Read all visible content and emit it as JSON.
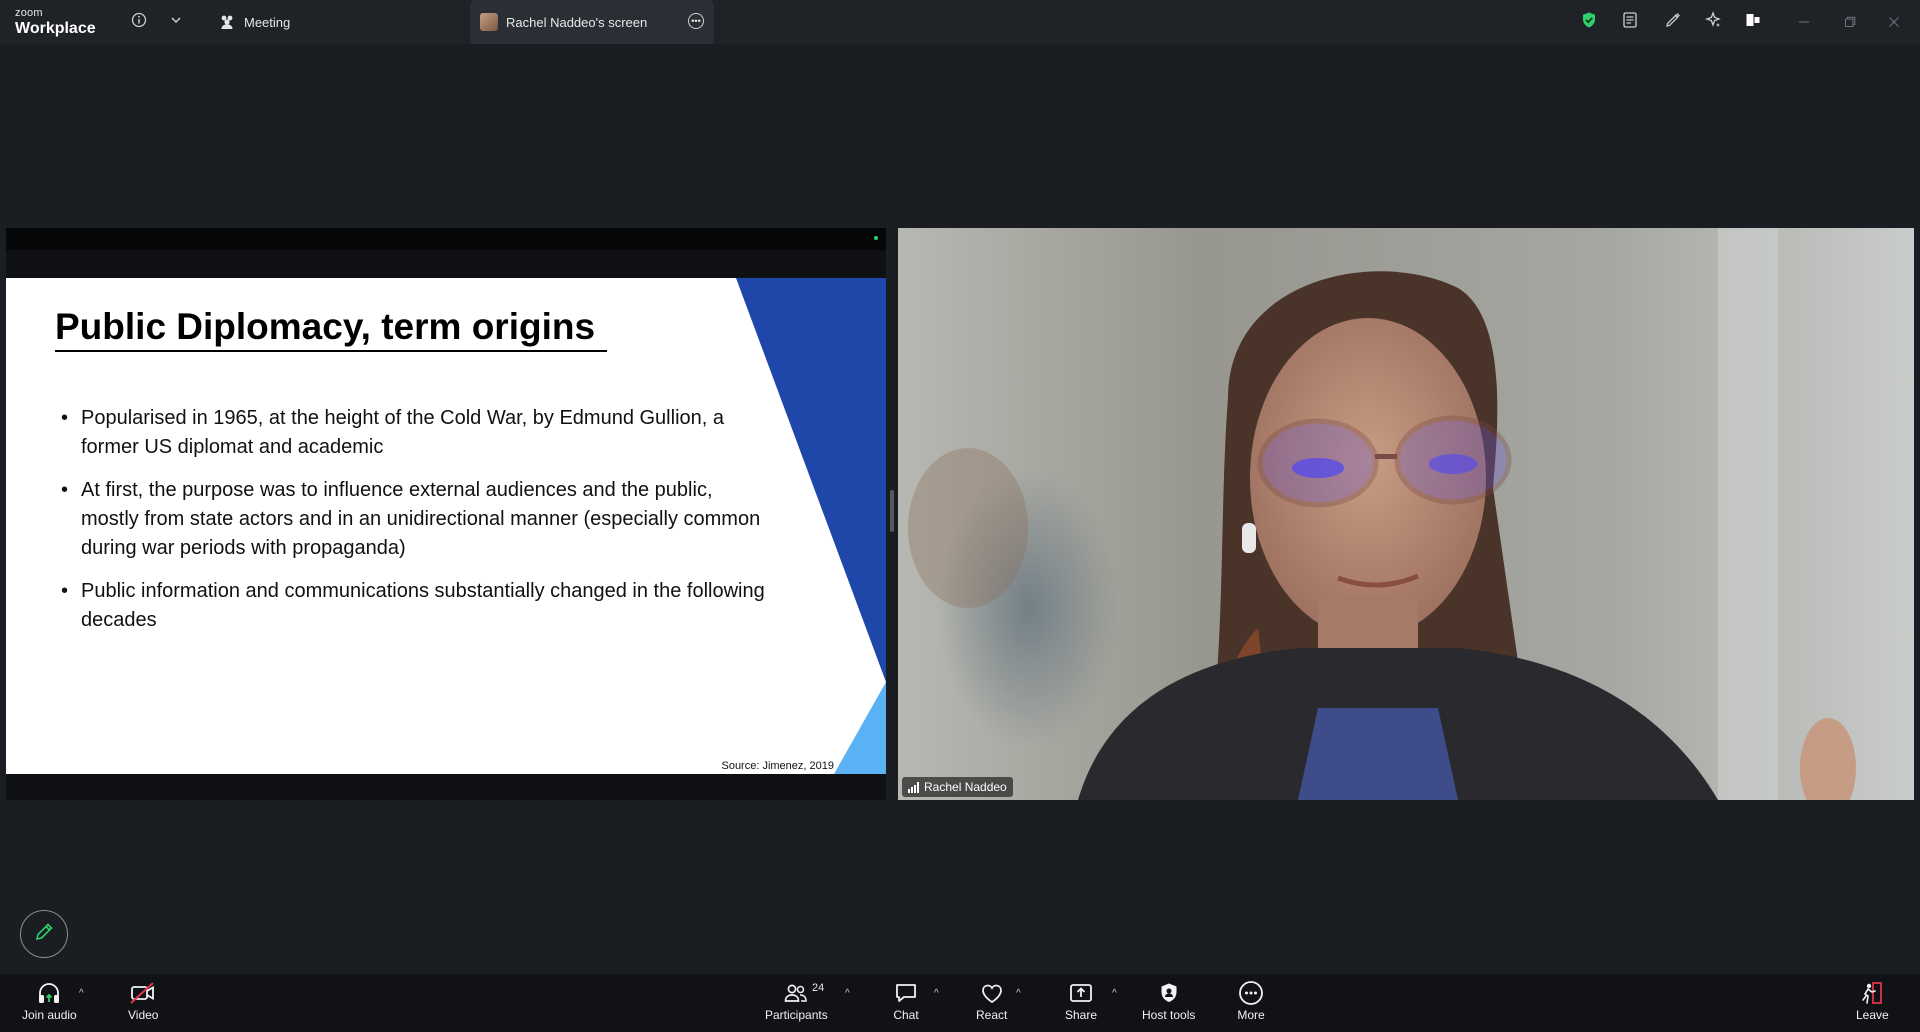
{
  "app": {
    "brand_small": "zoom",
    "brand_large": "Workplace"
  },
  "titlebar": {
    "info_icon": "info-icon",
    "dropdown_icon": "chevron-down-icon",
    "tab_meeting_label": "Meeting",
    "tab_screen_label": "Rachel Naddeo's screen",
    "right_icons": [
      "shield-check-icon",
      "notes-icon",
      "whiteboard-pen-icon",
      "ai-companion-icon",
      "apps-icon"
    ],
    "window_controls": [
      "minimize-icon",
      "restore-icon",
      "close-icon"
    ]
  },
  "slide": {
    "title": "Public Diplomacy, term origins",
    "bullets": [
      "Popularised in 1965, at the height of the Cold War, by Edmund Gullion, a former US diplomat and academic",
      "At first, the purpose was to influence external audiences and the public, mostly from state actors and in an unidirectional manner (especially common during war periods with propaganda)",
      "Public information and communications substantially changed in the following decades"
    ],
    "source": "Source: Jimenez, 2019",
    "colors": {
      "blue": "#1f47aa",
      "light_blue": "#5ab2f5"
    }
  },
  "video": {
    "participant_name": "Rachel Naddeo"
  },
  "toolbar": {
    "join_audio": "Join audio",
    "video": "Video",
    "participants": "Participants",
    "participants_count": "24",
    "chat": "Chat",
    "react": "React",
    "share": "Share",
    "host_tools": "Host tools",
    "more": "More",
    "leave": "Leave"
  },
  "colors": {
    "background": "#1a1d21",
    "toolbar": "#101215",
    "accent_green": "#2fd06b",
    "muted_red": "#e0344a"
  }
}
